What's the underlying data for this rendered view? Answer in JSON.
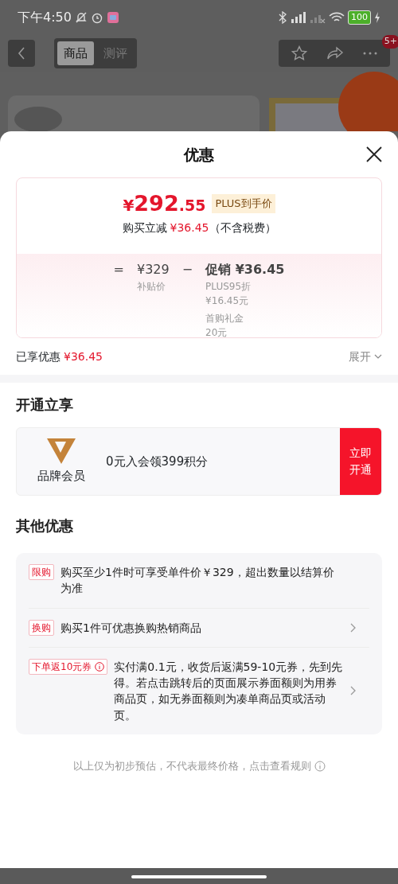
{
  "status_bar": {
    "time": "下午4:50",
    "battery": "100"
  },
  "nav": {
    "tabs": [
      {
        "label": "商品",
        "selected": true
      },
      {
        "label": "测评",
        "selected": false
      }
    ],
    "badge": "5+"
  },
  "sheet": {
    "title": "优惠",
    "price": {
      "symbol": "¥",
      "integer": "292",
      "decimal": ".55",
      "tag": "PLUS到手价",
      "saving_label": "购买立减",
      "saving": "¥36.45",
      "saving_note": "（不含税费）"
    },
    "breakdown": {
      "equals": "=",
      "base": "¥329",
      "base_label": "补贴价",
      "minus": "−",
      "promo": "促销 ¥36.45",
      "promo_items": [
        {
          "name": "PLUS95折",
          "amount": "¥16.45元"
        },
        {
          "name": "首购礼金",
          "amount": "20元"
        }
      ]
    },
    "enjoyed_label": "已享优惠",
    "enjoyed": "¥36.45",
    "expand": "展开"
  },
  "membership": {
    "heading": "开通立享",
    "brand": "品牌会员",
    "offer": "0元入会领399积分",
    "button": "立即开通"
  },
  "other": {
    "heading": "其他优惠",
    "items": [
      {
        "tag": "限购",
        "info": false,
        "text": "购买至少1件时可享受单件价￥329，超出数量以结算价为准",
        "arrow": false
      },
      {
        "tag": "换购",
        "info": false,
        "text": "购买1件可优惠换购热销商品",
        "arrow": true
      },
      {
        "tag": "下单返10元券",
        "info": true,
        "text": "实付满0.1元，收货后返满59-10元券，先到先得。若点击跳转后的页面展示券面额则为用券商品页，如无券面额则为凑单商品页或活动页。",
        "arrow": true
      }
    ]
  },
  "footer": "以上仅为初步预估，不代表最终价格，点击查看规则"
}
